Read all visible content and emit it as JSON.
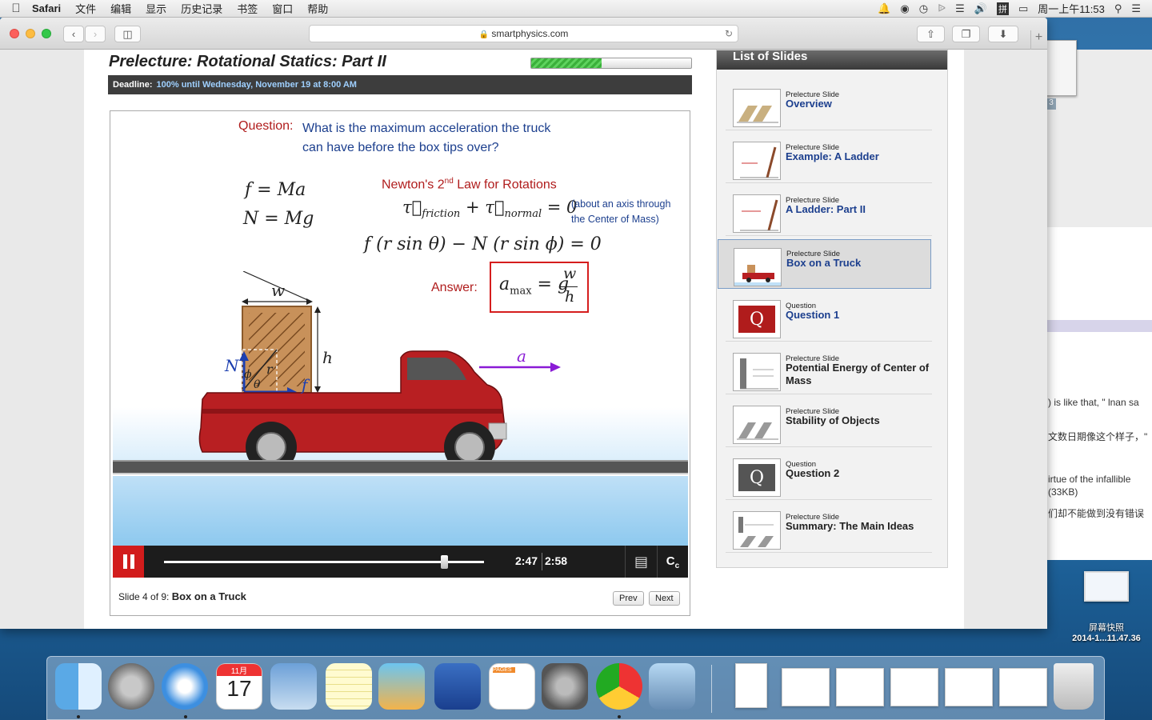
{
  "menubar": {
    "app_name": "Safari",
    "menus": [
      "文件",
      "编辑",
      "显示",
      "历史记录",
      "书签",
      "窗口",
      "帮助"
    ],
    "input_method": "拼",
    "clock": "周一上午11:53"
  },
  "browser": {
    "url": "smartphysics.com"
  },
  "lecture": {
    "title": "Prelecture: Rotational Statics: Part II",
    "progress_fraction": 0.44,
    "deadline_label": "Deadline:",
    "deadline_value": "100% until Wednesday, November 19 at 8:00 AM"
  },
  "slide": {
    "question_label": "Question:",
    "question_text": "What is the maximum acceleration the truck can have before the box tips over?",
    "newton_heading": "Newton's 2nd Law for Rotations",
    "axis_note": "(about an axis through the Center of Mass)",
    "answer_label": "Answer:",
    "labels": {
      "w": "w",
      "h": "h",
      "N": "N",
      "f": "f",
      "r": "r",
      "phi": "ϕ",
      "theta": "θ",
      "a": "a"
    }
  },
  "player": {
    "current_time": "2:47",
    "duration": "2:58",
    "position_fraction": 0.94,
    "cc_label": "C"
  },
  "slide_footer": {
    "counter": "Slide 4 of 9:",
    "name": "Box on a Truck",
    "prev": "Prev",
    "next": "Next"
  },
  "slide_list": {
    "heading": "List of Slides",
    "items": [
      {
        "kind": "Prelecture Slide",
        "title": "Overview"
      },
      {
        "kind": "Prelecture Slide",
        "title": "Example: A Ladder"
      },
      {
        "kind": "Prelecture Slide",
        "title": "A Ladder: Part II"
      },
      {
        "kind": "Prelecture Slide",
        "title": "Box on a Truck"
      },
      {
        "kind": "Question",
        "title": "Question 1"
      },
      {
        "kind": "Prelecture Slide",
        "title": "Potential Energy of Center of Mass"
      },
      {
        "kind": "Prelecture Slide",
        "title": "Stability of Objects"
      },
      {
        "kind": "Question",
        "title": "Question 2"
      },
      {
        "kind": "Prelecture Slide",
        "title": "Summary: The Main Ideas"
      }
    ]
  },
  "background_window": {
    "badge": "3",
    "lines": [
      ") is like that, \" lnan sa",
      "文数日期像这个样子，\"",
      "irtue of the infallible",
      "(33KB)",
      "们却不能做到没有错误"
    ]
  },
  "desktop_file": {
    "name": "屏幕快照",
    "date": "2014-1...11.47.36"
  },
  "dock": {
    "calendar_month": "11月",
    "calendar_day": "17",
    "pages_label": "PAGES"
  },
  "colors": {
    "question_red": "#b01c1c",
    "question_blue": "#1c3f8e",
    "pause_red": "#d21c1c",
    "progress_green": "#3bb03b"
  }
}
